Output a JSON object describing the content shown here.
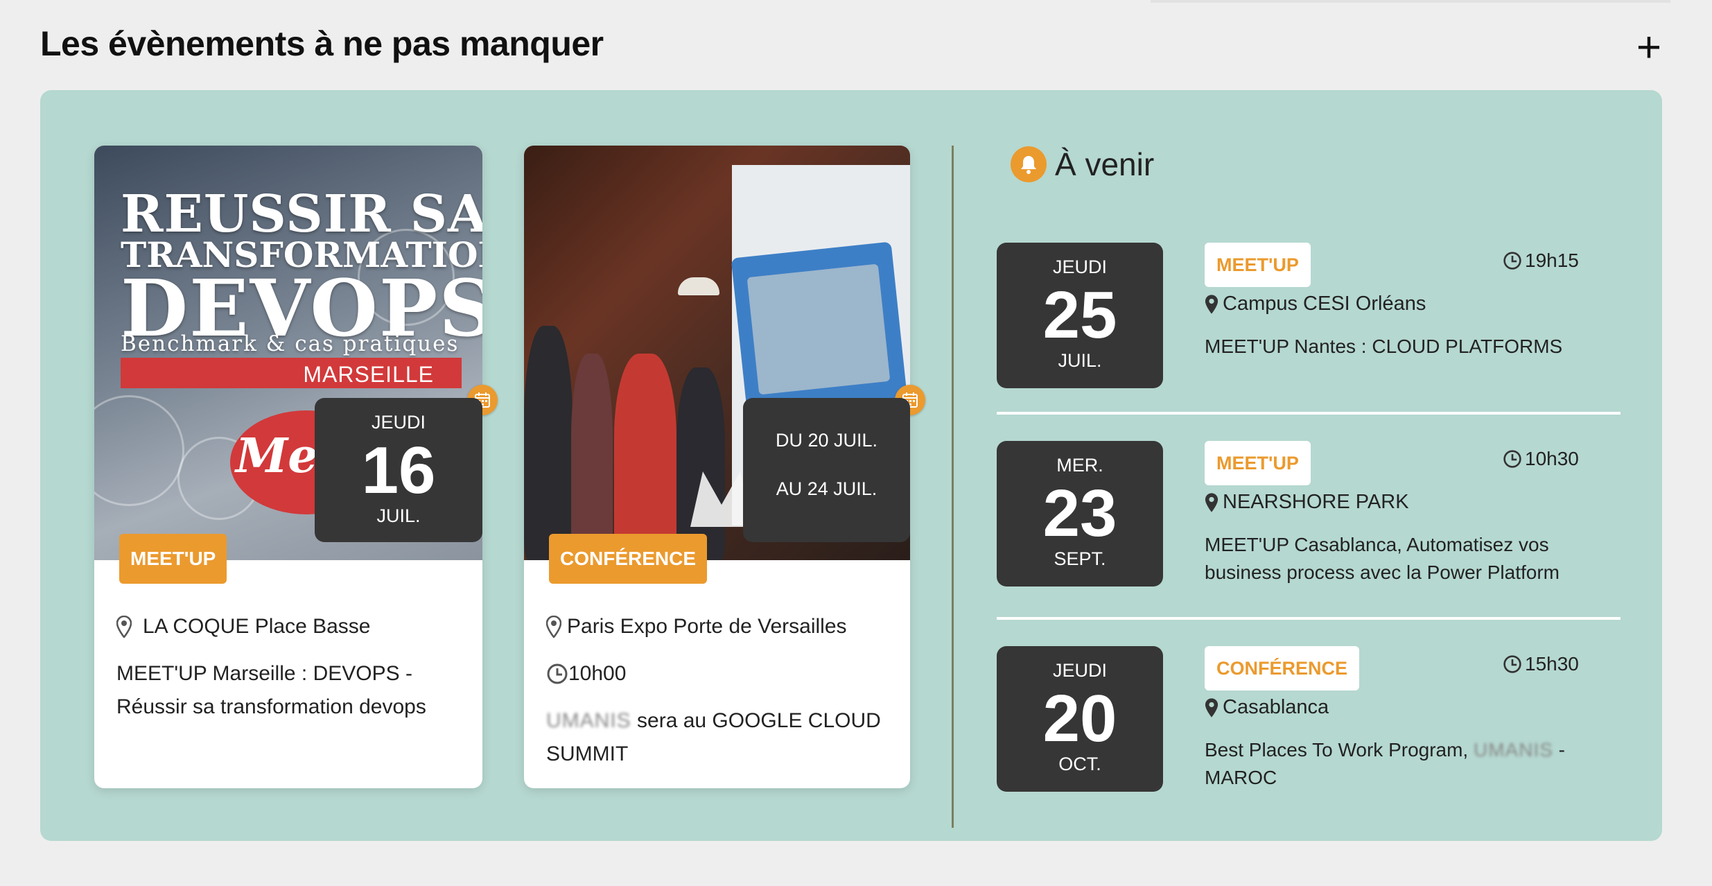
{
  "section": {
    "title": "Les évènements à ne pas manquer",
    "add_label": "+"
  },
  "featured": [
    {
      "poster": {
        "line1": "REUSSIR SA",
        "line2": "TRANSFORMATION",
        "line3": "DEVOPS",
        "line4": "Benchmark & cas pratiques",
        "city": "MARSEILLE",
        "brand": "Meet"
      },
      "date": {
        "day": "JEUDI",
        "num": "16",
        "month": "JUIL."
      },
      "tag": "MEET'UP",
      "location": "LA COQUE Place Basse",
      "description": "MEET'UP Marseille : DEVOPS - Réussir sa transformation devops"
    },
    {
      "date": {
        "from": "DU 20 JUIL.",
        "to": "AU 24 JUIL."
      },
      "tag": "CONFÉRENCE",
      "location": "Paris Expo Porte de Versailles",
      "time": "10h00",
      "description_company": "UMANIS",
      "description_rest": " sera au GOOGLE CLOUD SUMMIT"
    }
  ],
  "upcoming": {
    "title": "À venir",
    "events": [
      {
        "date": {
          "day": "JEUDI",
          "num": "25",
          "month": "JUIL."
        },
        "tag": "MEET'UP",
        "time": "19h15",
        "location": "Campus CESI Orléans",
        "title": "MEET'UP Nantes : CLOUD PLATFORMS"
      },
      {
        "date": {
          "day": "MER.",
          "num": "23",
          "month": "SEPT."
        },
        "tag": "MEET'UP",
        "time": "10h30",
        "location": "NEARSHORE PARK",
        "title": "MEET'UP Casablanca, Automatisez vos business process avec la Power Platform"
      },
      {
        "date": {
          "day": "JEUDI",
          "num": "20",
          "month": "OCT."
        },
        "tag": "CONFÉRENCE",
        "time": "15h30",
        "location": "Casablanca",
        "title_before": "Best Places To Work Program, ",
        "title_company": "UMANIS",
        "title_after": " - MAROC"
      }
    ]
  },
  "colors": {
    "accent": "#eb9a2e",
    "panel": "#b5d8d0",
    "badge": "#363636",
    "divider": "#7a8060"
  },
  "icons": [
    "plus-icon",
    "calendar-icon",
    "location-pin-icon",
    "clock-icon",
    "bell-icon"
  ]
}
